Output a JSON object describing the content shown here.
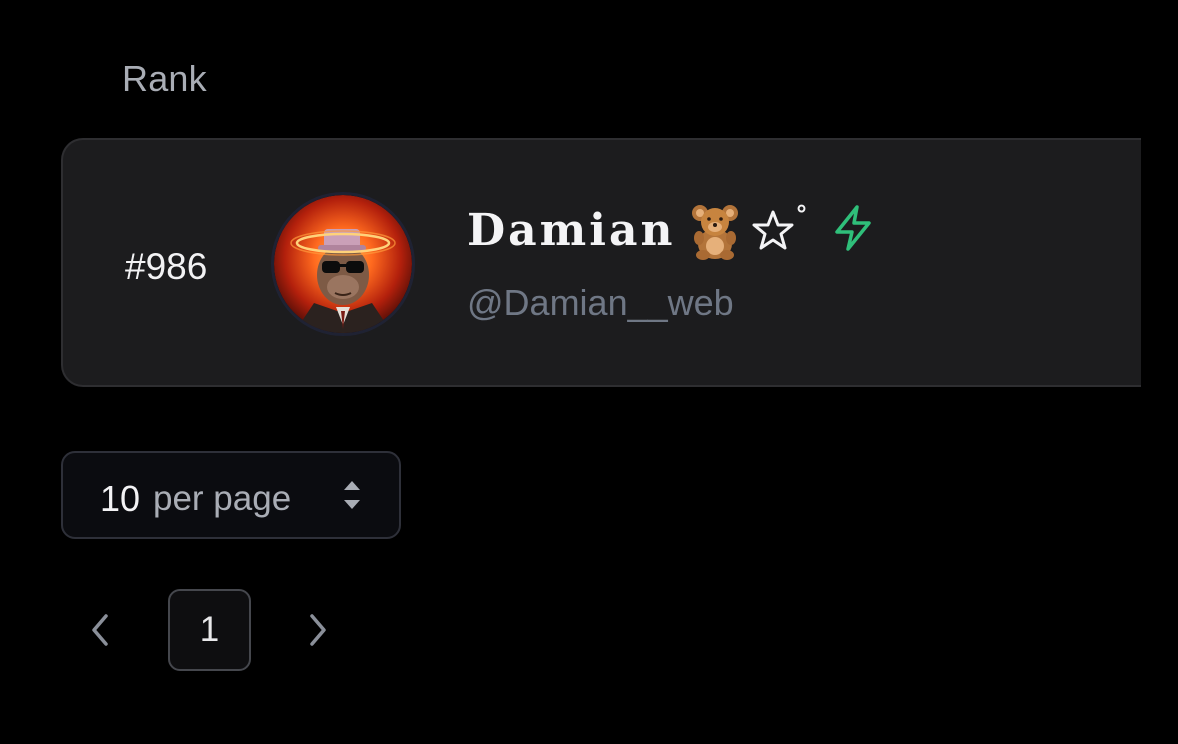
{
  "table": {
    "rank_header": "Rank",
    "rows": [
      {
        "rank": "#986",
        "display_name": "Damian",
        "name_suffix_symbol": "°",
        "handle": "@Damian__web",
        "avatar_icon": "avatar-portrait",
        "badge_icons": [
          "teddy-bear-icon",
          "star-outline-icon"
        ],
        "status_icon": "lightning-icon",
        "status_color": "#2fbf7a"
      }
    ]
  },
  "pagination": {
    "per_page_value": "10",
    "per_page_label": "per page",
    "current_page": "1",
    "prev_icon": "chevron-left-icon",
    "next_icon": "chevron-right-icon"
  },
  "colors": {
    "background": "#000000",
    "card": "#1c1c1e",
    "muted_text": "#6f7785",
    "accent_green": "#2fbf7a"
  }
}
